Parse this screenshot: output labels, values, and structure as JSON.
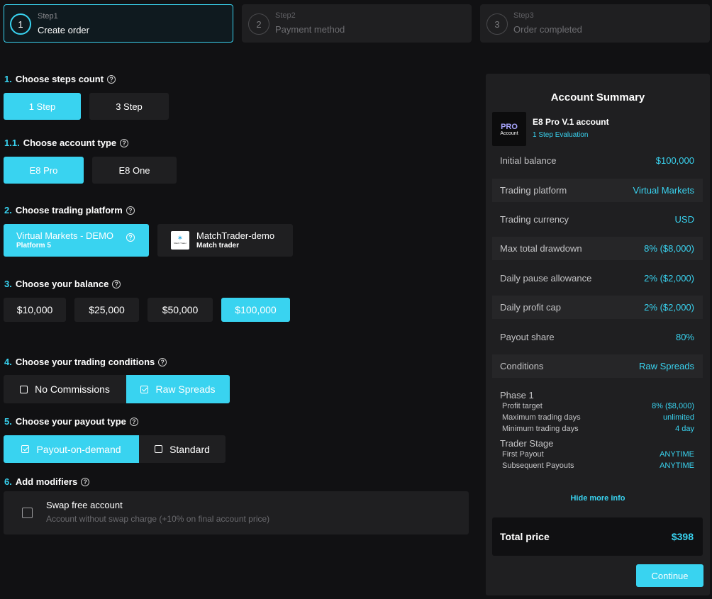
{
  "stepper": [
    {
      "num": "1",
      "label": "Step1",
      "title": "Create order"
    },
    {
      "num": "2",
      "label": "Step2",
      "title": "Payment method"
    },
    {
      "num": "3",
      "label": "Step3",
      "title": "Order completed"
    }
  ],
  "sections": {
    "steps_count": {
      "num": "1.",
      "title": "Choose steps count",
      "options": [
        "1 Step",
        "3 Step"
      ]
    },
    "account_type": {
      "num": "1.1.",
      "title": "Choose account type",
      "options": [
        "E8 Pro",
        "E8 One"
      ]
    },
    "platform": {
      "num": "2.",
      "title": "Choose trading platform",
      "vm_name": "Virtual Markets - DEMO",
      "vm_sub": "Platform 5",
      "mt_name": "MatchTrader-demo",
      "mt_sub": "Match trader",
      "mt_logo": "Match Trader"
    },
    "balance": {
      "num": "3.",
      "title": "Choose your balance",
      "options": [
        "$10,000",
        "$25,000",
        "$50,000",
        "$100,000"
      ]
    },
    "conditions": {
      "num": "4.",
      "title": "Choose your trading conditions",
      "options": [
        "No Commissions",
        "Raw Spreads"
      ]
    },
    "payout": {
      "num": "5.",
      "title": "Choose your payout type",
      "options": [
        "Payout-on-demand",
        "Standard"
      ]
    },
    "modifiers": {
      "num": "6.",
      "title": "Add modifiers",
      "swap_title": "Swap free account",
      "swap_desc": "Account without swap charge (+10% on final account price)"
    }
  },
  "summary": {
    "title": "Account Summary",
    "badge_top": "PRO",
    "badge_bottom": "Account",
    "account_name": "E8 Pro V.1 account",
    "account_sub": "1 Step Evaluation",
    "rows": [
      {
        "k": "Initial balance",
        "v": "$100,000"
      },
      {
        "k": "Trading platform",
        "v": "Virtual Markets"
      },
      {
        "k": "Trading currency",
        "v": "USD"
      },
      {
        "k": "Max total drawdown",
        "v": "8% ($8,000)"
      },
      {
        "k": "Daily pause allowance",
        "v": "2% ($2,000)"
      },
      {
        "k": "Daily profit cap",
        "v": "2% ($2,000)"
      },
      {
        "k": "Payout share",
        "v": "80%"
      },
      {
        "k": "Conditions",
        "v": "Raw Spreads"
      }
    ],
    "phase1": "Phase 1",
    "phase_rows": [
      {
        "k": "Profit target",
        "v": "8% ($8,000)"
      },
      {
        "k": "Maximum trading days",
        "v": "unlimited"
      },
      {
        "k": "Minimum trading days",
        "v": "4 day"
      }
    ],
    "trader_stage": "Trader Stage",
    "stage_rows": [
      {
        "k": "First Payout",
        "v": "ANYTIME"
      },
      {
        "k": "Subsequent Payouts",
        "v": "ANYTIME"
      }
    ],
    "hide_info": "Hide more info",
    "total_label": "Total price",
    "total_value": "$398",
    "continue": "Continue"
  },
  "colors": {
    "accent": "#39d3f0",
    "bg": "#111113",
    "card": "#1f1f21"
  }
}
